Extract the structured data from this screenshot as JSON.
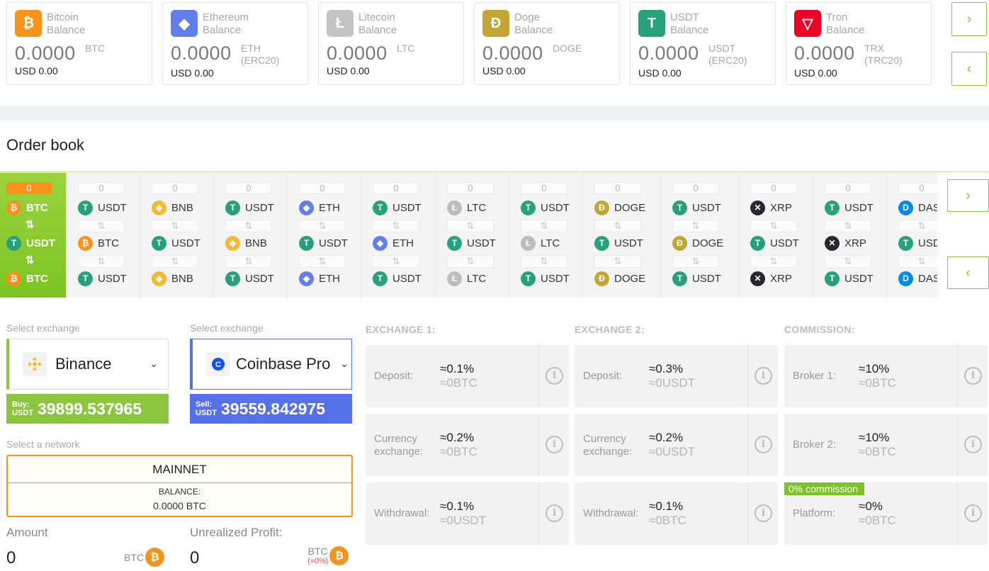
{
  "balances": [
    {
      "name": "Bitcoin",
      "sub": "Balance",
      "amount": "0.0000",
      "unit": "BTC",
      "unit2": "",
      "usd": "USD 0.00",
      "icon": "bitcoin-icon",
      "glyph": "₿",
      "color": "#f7931a"
    },
    {
      "name": "Ethereum",
      "sub": "Balance",
      "amount": "0.0000",
      "unit": "ETH",
      "unit2": "(ERC20)",
      "usd": "USD 0.00",
      "icon": "ethereum-icon",
      "glyph": "◆",
      "color": "#627eea"
    },
    {
      "name": "Litecoin",
      "sub": "Balance",
      "amount": "0.0000",
      "unit": "LTC",
      "unit2": "",
      "usd": "USD 0.00",
      "icon": "litecoin-icon",
      "glyph": "Ł",
      "color": "#c4c4c4"
    },
    {
      "name": "Doge",
      "sub": "Balance",
      "amount": "0.0000",
      "unit": "DOGE",
      "unit2": "",
      "usd": "USD 0.00",
      "icon": "doge-icon",
      "glyph": "Ð",
      "color": "#c2a633"
    },
    {
      "name": "USDT",
      "sub": "Balance",
      "amount": "0.0000",
      "unit": "USDT",
      "unit2": "(ERC20)",
      "usd": "USD 0.00",
      "icon": "usdt-icon",
      "glyph": "T",
      "color": "#26a17b"
    },
    {
      "name": "Tron",
      "sub": "Balance",
      "amount": "0.0000",
      "unit": "TRX",
      "unit2": "(TRC20)",
      "usd": "USD 0.00",
      "icon": "tron-icon",
      "glyph": "▽",
      "color": "#ef0027"
    }
  ],
  "nav": {
    "next": "›",
    "prev": "‹"
  },
  "orderbook": {
    "title": "Order book",
    "swap_glyph": "⇅",
    "pairs": [
      {
        "count": "0",
        "top": "BTC",
        "mid": "USDT",
        "bottom": "BTC"
      },
      {
        "count": "0",
        "top": "USDT",
        "mid": "BTC",
        "bottom": "USDT"
      },
      {
        "count": "0",
        "top": "BNB",
        "mid": "USDT",
        "bottom": "BNB"
      },
      {
        "count": "0",
        "top": "USDT",
        "mid": "BNB",
        "bottom": "USDT"
      },
      {
        "count": "0",
        "top": "ETH",
        "mid": "USDT",
        "bottom": "ETH"
      },
      {
        "count": "0",
        "top": "USDT",
        "mid": "ETH",
        "bottom": "USDT"
      },
      {
        "count": "0",
        "top": "LTC",
        "mid": "USDT",
        "bottom": "LTC"
      },
      {
        "count": "0",
        "top": "USDT",
        "mid": "LTC",
        "bottom": "USDT"
      },
      {
        "count": "0",
        "top": "DOGE",
        "mid": "USDT",
        "bottom": "DOGE"
      },
      {
        "count": "0",
        "top": "USDT",
        "mid": "DOGE",
        "bottom": "USDT"
      },
      {
        "count": "0",
        "top": "XRP",
        "mid": "USDT",
        "bottom": "XRP"
      },
      {
        "count": "0",
        "top": "USDT",
        "mid": "XRP",
        "bottom": "USDT"
      },
      {
        "count": "0",
        "top": "DASH",
        "mid": "USDT",
        "bottom": "DASH"
      }
    ]
  },
  "exchange": {
    "select_label": "Select exchange",
    "left": {
      "name": "Binance",
      "price_label_1": "Buy:",
      "price_label_2": "USDT",
      "price": "39899.537965",
      "color": "#8cc63f",
      "chevron": "⌄"
    },
    "right": {
      "name": "Coinbase Pro",
      "price_label_1": "Sell:",
      "price_label_2": "USDT",
      "price": "39559.842975",
      "color": "#5671e8",
      "chevron": "⌄"
    },
    "network_label": "Select a network",
    "network": "MAINNET",
    "balance_caption": "BALANCE:",
    "balance_value": "0.0000 BTC",
    "amount_label": "Amount",
    "amount_value": "0",
    "amount_unit": "BTC",
    "profit_label": "Unrealized Profit:",
    "profit_value": "0",
    "profit_unit": "BTC",
    "profit_pct": "(≈0%)"
  },
  "fees": {
    "headers": [
      "EXCHANGE 1:",
      "EXCHANGE 2:",
      "COMMISSION:"
    ],
    "info_glyph": "i",
    "zero_tag": "0% commission",
    "cols": [
      [
        {
          "label": [
            "Deposit:"
          ],
          "pct": "≈0.1%",
          "amt": "≈0BTC"
        },
        {
          "label": [
            "Currency",
            "exchange:"
          ],
          "pct": "≈0.2%",
          "amt": "≈0BTC"
        },
        {
          "label": [
            "Withdrawal:"
          ],
          "pct": "≈0.1%",
          "amt": "≈0USDT"
        }
      ],
      [
        {
          "label": [
            "Deposit:"
          ],
          "pct": "≈0.3%",
          "amt": "≈0USDT"
        },
        {
          "label": [
            "Currency",
            "exchange:"
          ],
          "pct": "≈0.2%",
          "amt": "≈0USDT"
        },
        {
          "label": [
            "Withdrawal:"
          ],
          "pct": "≈0.1%",
          "amt": "≈0BTC"
        }
      ],
      [
        {
          "label": [
            "Broker 1:"
          ],
          "pct": "≈10%",
          "amt": "≈0BTC"
        },
        {
          "label": [
            "Broker 2:"
          ],
          "pct": "≈10%",
          "amt": "≈0BTC"
        },
        {
          "label": [
            "Platform:"
          ],
          "pct": "≈0%",
          "amt": "≈0BTC"
        }
      ]
    ]
  },
  "colors": {
    "accent_green": "#8cc63f",
    "btc_orange": "#f7931a",
    "coinbase_blue": "#5671e8"
  }
}
